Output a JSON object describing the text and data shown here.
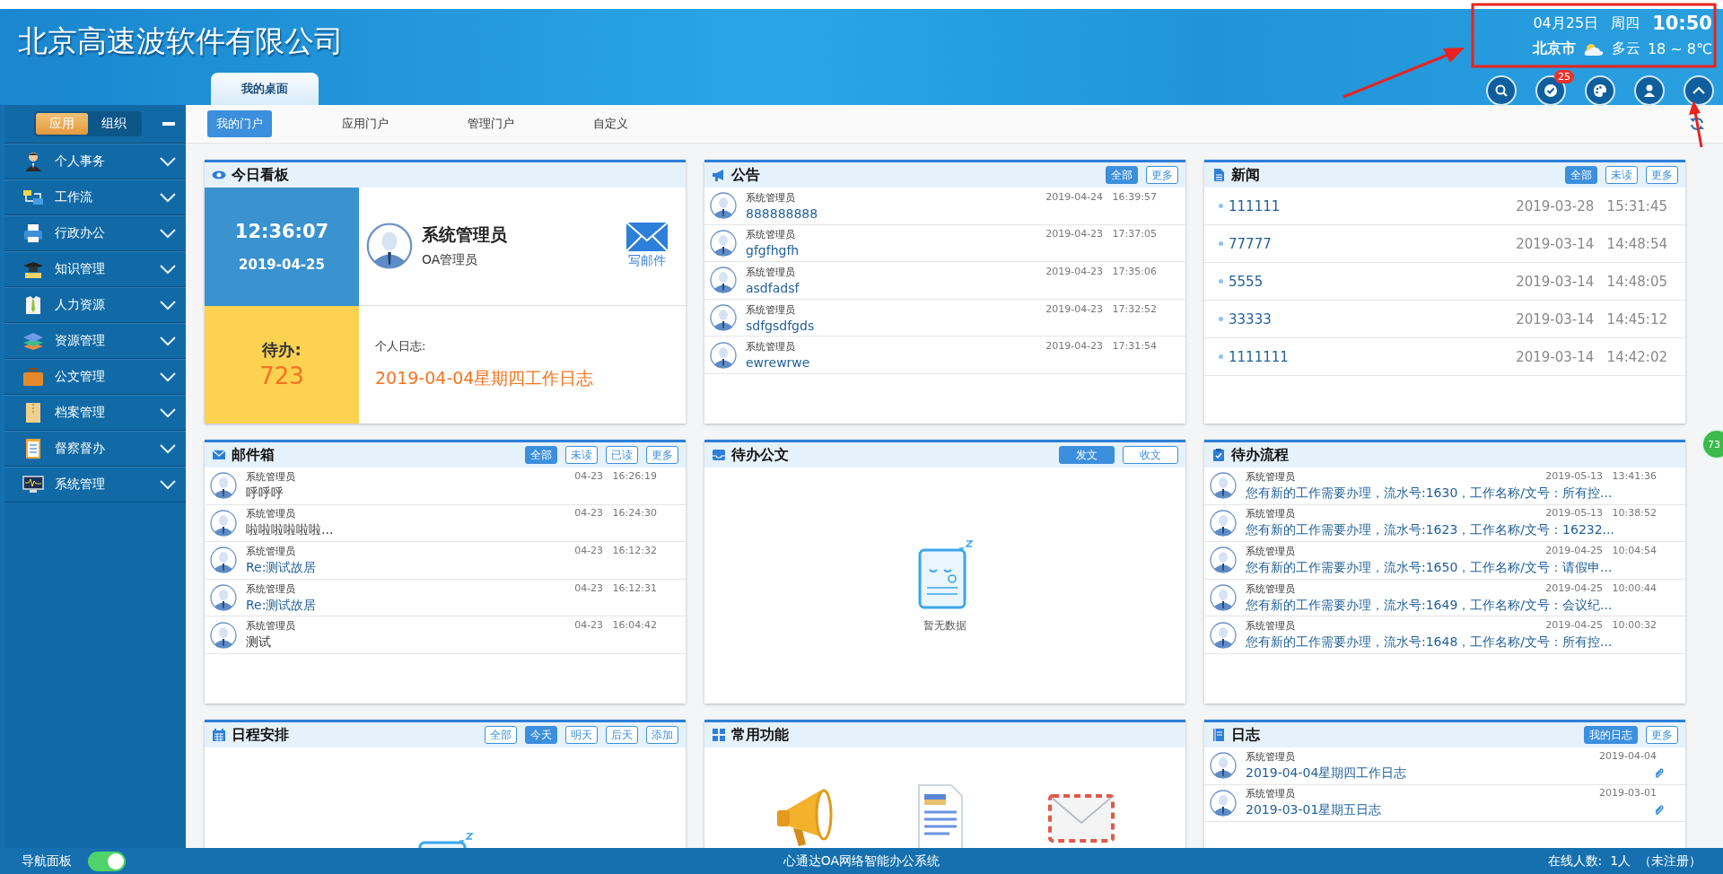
{
  "header": {
    "company": "北京高速波软件有限公司",
    "date": "04月25日",
    "weekday": "周四",
    "time": "10:50",
    "city": "北京市",
    "weather": "多云",
    "temperature": "18 ~ 8℃",
    "tool_icons": [
      {
        "kind": "search"
      },
      {
        "kind": "todo",
        "badge": "25"
      },
      {
        "kind": "palette"
      },
      {
        "kind": "user"
      },
      {
        "kind": "collapse"
      }
    ]
  },
  "top_tabs": [
    {
      "label": "我的桌面",
      "selected": true
    }
  ],
  "sidebar": {
    "modes": [
      {
        "label": "应用",
        "selected": true
      },
      {
        "label": "组织",
        "selected": false
      }
    ],
    "items": [
      {
        "label": "个人事务",
        "kind": "person"
      },
      {
        "label": "工作流",
        "kind": "flow"
      },
      {
        "label": "行政办公",
        "kind": "printer"
      },
      {
        "label": "知识管理",
        "kind": "cap"
      },
      {
        "label": "人力资源",
        "kind": "shirt"
      },
      {
        "label": "资源管理",
        "kind": "layers"
      },
      {
        "label": "公文管理",
        "kind": "briefcase"
      },
      {
        "label": "档案管理",
        "kind": "folder"
      },
      {
        "label": "督察督办",
        "kind": "clipboard"
      },
      {
        "label": "系统管理",
        "kind": "monitor"
      }
    ]
  },
  "portal_tabs": [
    {
      "label": "我的门户",
      "selected": true
    },
    {
      "label": "应用门户",
      "selected": false
    },
    {
      "label": "管理门户",
      "selected": false
    },
    {
      "label": "自定义",
      "selected": false
    }
  ],
  "panels": [
    {
      "title": "今日看板",
      "kind": "dashboard",
      "clock": "12:36:07",
      "day": "2019-04-25",
      "user_name": "系统管理员",
      "user_role": "OA管理员",
      "mail_label": "写邮件",
      "todo_label": "待办:",
      "todo_count": "723",
      "log_label": "个人日志:",
      "log_title": "2019-04-04星期四工作日志"
    },
    {
      "title": "公告",
      "kind": "avatar_list",
      "buttons": [
        {
          "label": "全部",
          "selected": true
        },
        {
          "label": "更多",
          "selected": false
        }
      ],
      "rows": [
        {
          "author": "系统管理员",
          "date": "2019-04-24",
          "time": "16:39:57",
          "title": "888888888"
        },
        {
          "author": "系统管理员",
          "date": "2019-04-23",
          "time": "17:37:05",
          "title": "gfgfhgfh"
        },
        {
          "author": "系统管理员",
          "date": "2019-04-23",
          "time": "17:35:06",
          "title": "asdfadsf"
        },
        {
          "author": "系统管理员",
          "date": "2019-04-23",
          "time": "17:32:52",
          "title": "sdfgsdfgds"
        },
        {
          "author": "系统管理员",
          "date": "2019-04-23",
          "time": "17:31:54",
          "title": "ewrewrwe"
        }
      ]
    },
    {
      "title": "新闻",
      "kind": "news",
      "buttons": [
        {
          "label": "全部",
          "selected": true
        },
        {
          "label": "未读",
          "selected": false
        },
        {
          "label": "更多",
          "selected": false
        }
      ],
      "rows": [
        {
          "title": "111111",
          "date": "2019-03-28",
          "time": "15:31:45"
        },
        {
          "title": "77777",
          "date": "2019-03-14",
          "time": "14:48:54"
        },
        {
          "title": "5555",
          "date": "2019-03-14",
          "time": "14:48:05"
        },
        {
          "title": "33333",
          "date": "2019-03-14",
          "time": "14:45:12"
        },
        {
          "title": "1111111",
          "date": "2019-03-14",
          "time": "14:42:02"
        }
      ]
    },
    {
      "title": "邮件箱",
      "kind": "avatar_list",
      "buttons": [
        {
          "label": "全部",
          "selected": true
        },
        {
          "label": "未读",
          "selected": false
        },
        {
          "label": "已读",
          "selected": false
        },
        {
          "label": "更多",
          "selected": false
        }
      ],
      "rows": [
        {
          "author": "系统管理员",
          "date": "04-23",
          "time": "16:26:19",
          "title": "呼呼呼",
          "read": false
        },
        {
          "author": "系统管理员",
          "date": "04-23",
          "time": "16:24:30",
          "title": "啦啦啦啦啦啦...",
          "read": false
        },
        {
          "author": "系统管理员",
          "date": "04-23",
          "time": "16:12:32",
          "title": "Re:测试故居",
          "read": true
        },
        {
          "author": "系统管理员",
          "date": "04-23",
          "time": "16:12:31",
          "title": "Re:测试故居",
          "read": true
        },
        {
          "author": "系统管理员",
          "date": "04-23",
          "time": "16:04:42",
          "title": "测试",
          "read": false
        }
      ]
    },
    {
      "title": "待办公文",
      "kind": "empty",
      "buttons": [
        {
          "label": "发文",
          "selected": true
        },
        {
          "label": "收文",
          "selected": false
        }
      ],
      "empty_label": "暂无数据"
    },
    {
      "title": "待办流程",
      "kind": "avatar_list",
      "rows": [
        {
          "author": "系统管理员",
          "date": "2019-05-13",
          "time": "13:41:36",
          "title": "您有新的工作需要办理，流水号:1630，工作名称/文号：所有控..."
        },
        {
          "author": "系统管理员",
          "date": "2019-05-13",
          "time": "10:38:52",
          "title": "您有新的工作需要办理，流水号:1623，工作名称/文号：16232..."
        },
        {
          "author": "系统管理员",
          "date": "2019-04-25",
          "time": "10:04:54",
          "title": "您有新的工作需要办理，流水号:1650，工作名称/文号：请假申..."
        },
        {
          "author": "系统管理员",
          "date": "2019-04-25",
          "time": "10:00:44",
          "title": "您有新的工作需要办理，流水号:1649，工作名称/文号：会议纪..."
        },
        {
          "author": "系统管理员",
          "date": "2019-04-25",
          "time": "10:00:32",
          "title": "您有新的工作需要办理，流水号:1648，工作名称/文号：所有控..."
        }
      ]
    },
    {
      "title": "日程安排",
      "kind": "empty",
      "buttons": [
        {
          "label": "全部",
          "selected": false
        },
        {
          "label": "今天",
          "selected": true
        },
        {
          "label": "明天",
          "selected": false
        },
        {
          "label": "后天",
          "selected": false
        },
        {
          "label": "添加",
          "selected": false
        }
      ]
    },
    {
      "title": "常用功能",
      "kind": "shortcuts",
      "items": [
        {
          "kind": "megaphone"
        },
        {
          "kind": "document"
        },
        {
          "kind": "envelope"
        }
      ]
    },
    {
      "title": "日志",
      "kind": "avatar_list",
      "buttons": [
        {
          "label": "我的日志",
          "selected": true
        },
        {
          "label": "更多",
          "selected": false
        }
      ],
      "rows": [
        {
          "author": "系统管理员",
          "date": "2019-04-04",
          "title": "2019-04-04星期四工作日志",
          "attachment": true
        },
        {
          "author": "系统管理员",
          "date": "2019-03-01",
          "title": "2019-03-01星期五日志",
          "attachment": true
        }
      ]
    }
  ],
  "side_badge": "73",
  "footer": {
    "nav_label": "导航面板",
    "nav_on": true,
    "system_name": "心通达OA网络智能办公系统",
    "online": "在线人数:  1人  （未注册）"
  }
}
